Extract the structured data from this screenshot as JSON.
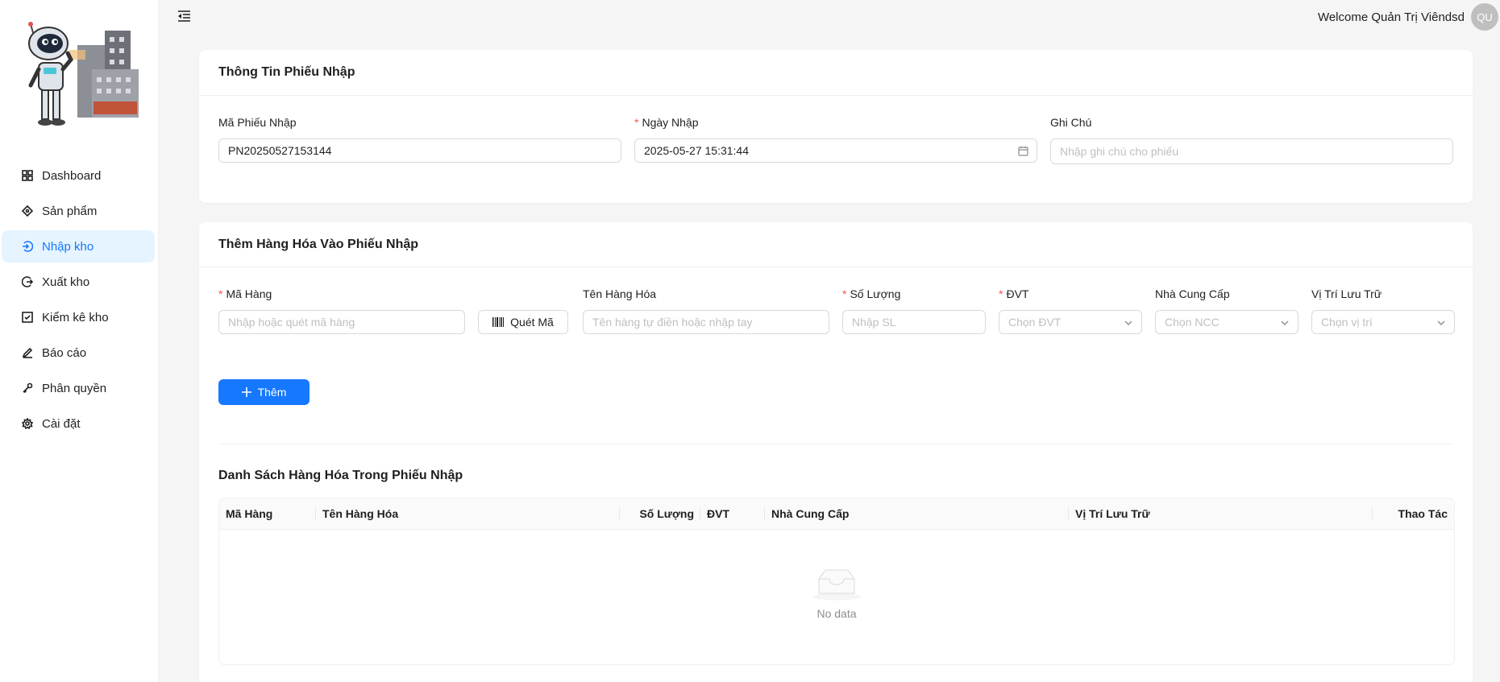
{
  "header": {
    "welcome_text": "Welcome Quản Trị Viêndsd",
    "avatar_initials": "QU"
  },
  "sidebar": {
    "items": [
      {
        "label": "Dashboard",
        "icon": "dashboard-icon",
        "active": false
      },
      {
        "label": "Sản phẩm",
        "icon": "product-icon",
        "active": false
      },
      {
        "label": "Nhập kho",
        "icon": "import-icon",
        "active": true
      },
      {
        "label": "Xuất kho",
        "icon": "export-icon",
        "active": false
      },
      {
        "label": "Kiểm kê kho",
        "icon": "checklist-icon",
        "active": false
      },
      {
        "label": "Báo cáo",
        "icon": "edit-icon",
        "active": false
      },
      {
        "label": "Phân quyền",
        "icon": "key-icon",
        "active": false
      },
      {
        "label": "Cài đặt",
        "icon": "gear-icon",
        "active": false
      }
    ]
  },
  "receipt_info": {
    "title": "Thông Tin Phiếu Nhập",
    "code_label": "Mã Phiếu Nhập",
    "code_value": "PN20250527153144",
    "date_label": "Ngày Nhập",
    "date_value": "2025-05-27 15:31:44",
    "note_label": "Ghi Chú",
    "note_placeholder": "Nhập ghi chú cho phiếu"
  },
  "add_item": {
    "title": "Thêm Hàng Hóa Vào Phiếu Nhập",
    "item_code_label": "Mã Hàng",
    "item_code_placeholder": "Nhập hoặc quét mã hàng",
    "scan_button": "Quét Mã",
    "item_name_label": "Tên Hàng Hóa",
    "item_name_placeholder": "Tên hàng tự điền hoặc nhập tay",
    "qty_label": "Số Lượng",
    "qty_placeholder": "Nhập SL",
    "unit_label": "ĐVT",
    "unit_placeholder": "Chọn ĐVT",
    "supplier_label": "Nhà Cung Cấp",
    "supplier_placeholder": "Chọn NCC",
    "location_label": "Vị Trí Lưu Trữ",
    "location_placeholder": "Chọn vị trí",
    "add_button": "Thêm"
  },
  "item_list": {
    "title": "Danh Sách Hàng Hóa Trong Phiếu Nhập",
    "columns": [
      "Mã Hàng",
      "Tên Hàng Hóa",
      "Số Lượng",
      "ĐVT",
      "Nhà Cung Cấp",
      "Vị Trí Lưu Trữ",
      "Thao Tác"
    ],
    "empty_text": "No data"
  },
  "colors": {
    "primary": "#1677ff",
    "active_bg": "#e6f4ff",
    "required": "#ff4d4f"
  }
}
